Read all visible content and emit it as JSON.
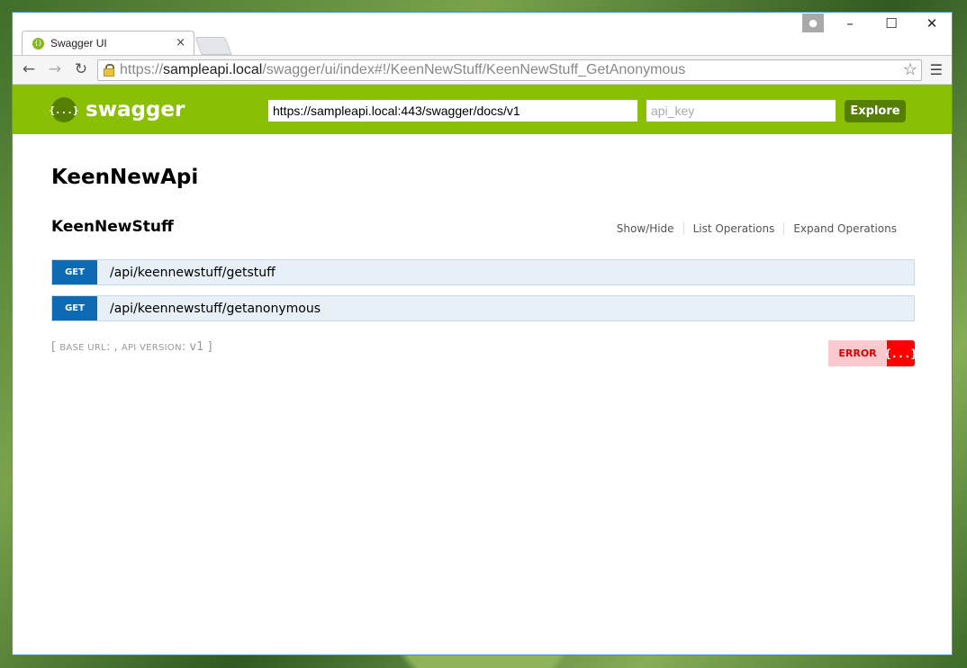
{
  "browser": {
    "tab_title": "Swagger UI",
    "tab_close": "×",
    "url_scheme": "https://",
    "url_host": "sampleapi.local",
    "url_path": "/swagger/ui/index#!/KeenNewStuff/KeenNewStuff_GetAnonymous"
  },
  "swagger": {
    "logo_text": "swagger",
    "logo_glyph": "{...}",
    "docs_url": "https://sampleapi.local:443/swagger/docs/v1",
    "api_key_placeholder": "api_key",
    "explore_label": "Explore"
  },
  "api": {
    "title": "KeenNewApi",
    "resource": {
      "name": "KeenNewStuff",
      "links": [
        "Show/Hide",
        "List Operations",
        "Expand Operations"
      ],
      "operations": [
        {
          "method": "GET",
          "path": "/api/keennewstuff/getstuff"
        },
        {
          "method": "GET",
          "path": "/api/keennewstuff/getanonymous"
        }
      ]
    },
    "footer": {
      "open_bracket": "[",
      "base_url_label": "base url",
      "base_url_value": ": ,",
      "api_version_label": "api version",
      "api_version_value": ": v1",
      "close_bracket": "]"
    }
  },
  "validator": {
    "error_label": "ERROR",
    "icon_glyph": "{...}"
  },
  "colors": {
    "swagger_green": "#89bf04",
    "swagger_dark_green": "#547f00",
    "get_blue": "#0f6ab4",
    "op_background": "#e7f0f7",
    "error_red": "#ff0000"
  }
}
